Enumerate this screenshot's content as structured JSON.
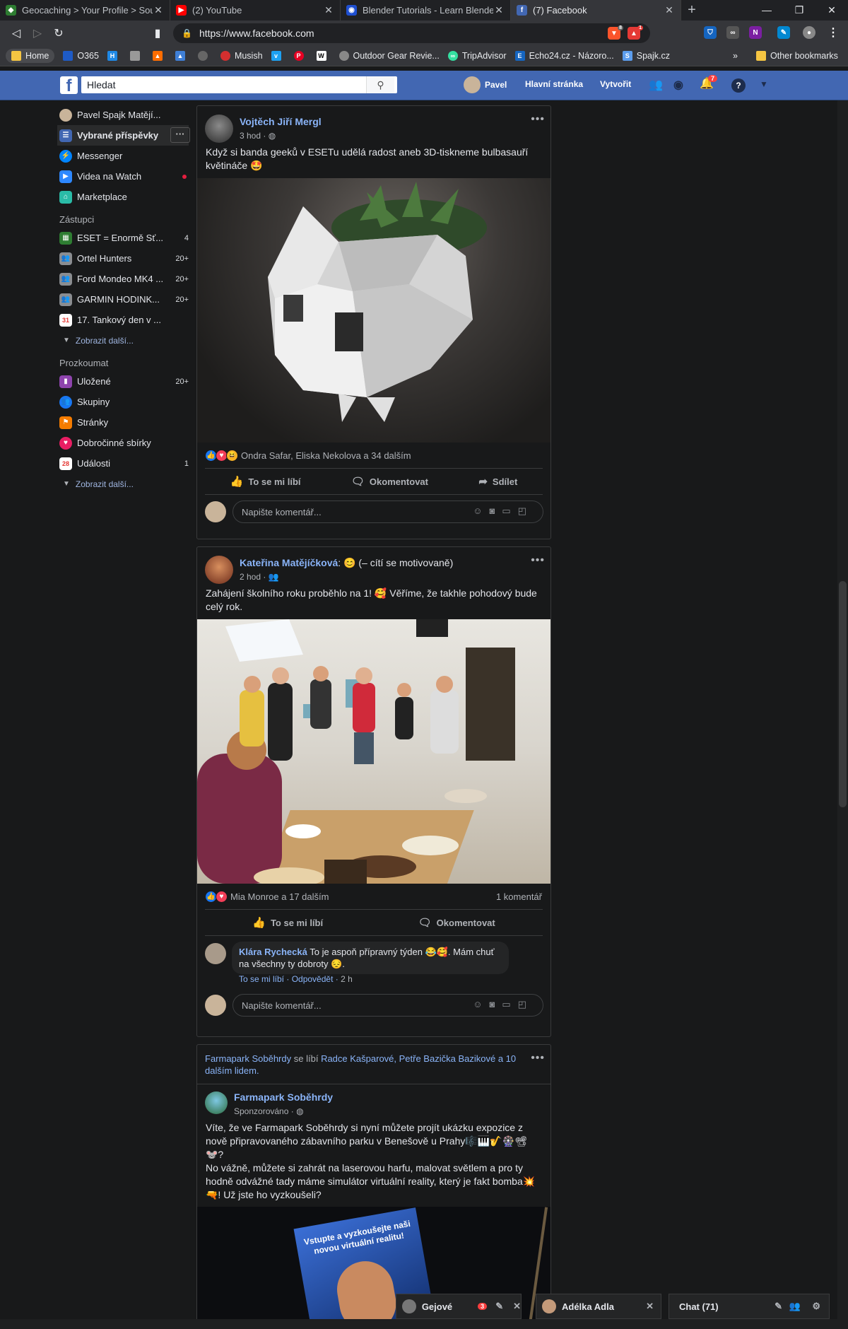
{
  "browser": {
    "tabs": [
      {
        "title": "Geocaching > Your Profile > Souv",
        "icon_color": "#2e7d32",
        "active": false
      },
      {
        "title": "(2) YouTube",
        "icon_color": "#ff0000",
        "active": false
      },
      {
        "title": "Blender Tutorials - Learn Blender",
        "icon_color": "#1e4fd1",
        "active": false
      },
      {
        "title": "(7) Facebook",
        "icon_color": "#4267b2",
        "active": true
      }
    ],
    "url": "https://www.facebook.com",
    "bookmarks": [
      {
        "label": "Home",
        "color": "#f5c542"
      },
      {
        "label": "O365",
        "color": "#1e5bc6"
      },
      {
        "label": "",
        "color": "#1e88e5"
      },
      {
        "label": "",
        "color": "#999999"
      },
      {
        "label": "",
        "color": "#ff6d00"
      },
      {
        "label": "",
        "color": "#3f7fd6"
      },
      {
        "label": "",
        "color": "#666666"
      },
      {
        "label": "Musish",
        "color": "#d32f2f"
      },
      {
        "label": "",
        "color": "#1da1f2"
      },
      {
        "label": "",
        "color": "#e60023"
      },
      {
        "label": "",
        "color": "#ffffff"
      },
      {
        "label": "Outdoor Gear Revie...",
        "color": "#888888"
      },
      {
        "label": "TripAdvisor",
        "color": "#34e0a1"
      },
      {
        "label": "Echo24.cz - Názoro...",
        "color": "#1565c0"
      },
      {
        "label": "Spajk.cz",
        "color": "#5c9ded"
      }
    ],
    "bookmarks_more": "»",
    "other_bookmarks": "Other bookmarks",
    "brave_badge": "8",
    "alert_badge": "1"
  },
  "fb": {
    "logo": "f",
    "search_placeholder": "Hledat",
    "user": "Pavel",
    "home": "Hlavní stránka",
    "create": "Vytvořit",
    "notif_count": "7"
  },
  "sidebar": {
    "profile": "Pavel Spajk Matějí...",
    "main": [
      {
        "label": "Vybrané příspěvky",
        "icon": "news-feed-icon",
        "color": "#4267b2"
      },
      {
        "label": "Messenger",
        "icon": "messenger-icon",
        "color": "#0084ff"
      },
      {
        "label": "Videa na Watch",
        "icon": "watch-icon",
        "color": "#2d88ff"
      },
      {
        "label": "Marketplace",
        "icon": "marketplace-icon",
        "color": "#2abba7"
      }
    ],
    "shortcuts_heading": "Zástupci",
    "shortcuts": [
      {
        "label": "ESET = Enormě Sť...",
        "count": "4",
        "color": "#2e7d32"
      },
      {
        "label": "Ortel Hunters",
        "count": "20+",
        "color": "#8a8d91"
      },
      {
        "label": "Ford Mondeo MK4 ...",
        "count": "20+",
        "color": "#8a8d91"
      },
      {
        "label": "GARMIN HODINK...",
        "count": "20+",
        "color": "#8a8d91"
      },
      {
        "label": "17. Tankový den v ...",
        "count": "",
        "color": "#e53935"
      }
    ],
    "show_more_1": "Zobrazit další...",
    "explore_heading": "Prozkoumat",
    "explore": [
      {
        "label": "Uložené",
        "count": "20+",
        "color": "#8e44ad"
      },
      {
        "label": "Skupiny",
        "count": "",
        "color": "#1877f2"
      },
      {
        "label": "Stránky",
        "count": "",
        "color": "#f57c00"
      },
      {
        "label": "Dobročinné sbírky",
        "count": "",
        "color": "#e91e63"
      },
      {
        "label": "Události",
        "count": "1",
        "color": "#e53935"
      }
    ],
    "show_more_2": "Zobrazit další..."
  },
  "posts": [
    {
      "author": "Vojtěch Jiří Mergl",
      "time": "3 hod",
      "text": "Když si banda geeků v ESETu udělá radost aneb 3D-tiskneme bulbasauří květináče 🤩",
      "reactions": "Ondra Safar, Eliska Nekolova a 34 dalším",
      "like": "To se mi líbí",
      "comment": "Okomentovat",
      "share": "Sdílet",
      "comment_placeholder": "Napište komentář..."
    },
    {
      "author": "Kateřina Matějíčková",
      "feeling": "😊 (– cítí se motivovaně)",
      "time": "2 hod",
      "text": "Zahájení školního roku proběhlo na 1! 🥰 Věříme, že takhle pohodový bude celý rok.",
      "reactions": "Mia Monroe a 17 dalším",
      "comments_count": "1 komentář",
      "like": "To se mi líbí",
      "comment": "Okomentovat",
      "reply_author": "Klára Rychecká",
      "reply_text": "To je aspoň přípravný týden 😂🥰. Mám chuť na všechny ty dobroty 😔.",
      "reply_like": "To se mi líbí",
      "reply_reply": "Odpovědět",
      "reply_time": "2 h",
      "comment_placeholder": "Napište komentář..."
    },
    {
      "context_page": "Farmapark Soběhrdy",
      "context_verb": "se líbí",
      "context_names": "Radce Kašparové, Petře Bazička Bazikové",
      "context_tail": "a 10 dalším lidem.",
      "author": "Farmapark Soběhrdy",
      "time": "Sponzorováno",
      "text": "Víte, že ve Farmapark Soběhrdy si nyní můžete projít ukázku expozice z nově připravovaného zábavního parku v Benešově u Prahy🎼🎹🎷🎡📽🐭?\nNo vážně, můžete si zahrát na laserovou harfu, malovat světlem a pro ty hodně odvážné tady máme simulátor virtuální reality, který je fakt bomba💥🔫! Už jste ho vyzkoušeli?",
      "ad_text": "Vstupte a vyzkoušejte naši novou virtuální realitu!"
    }
  ],
  "chat": {
    "gejove": "Gejové",
    "gejove_count": "3",
    "adelka": "Adélka Adla",
    "chat_label": "Chat (71)"
  }
}
